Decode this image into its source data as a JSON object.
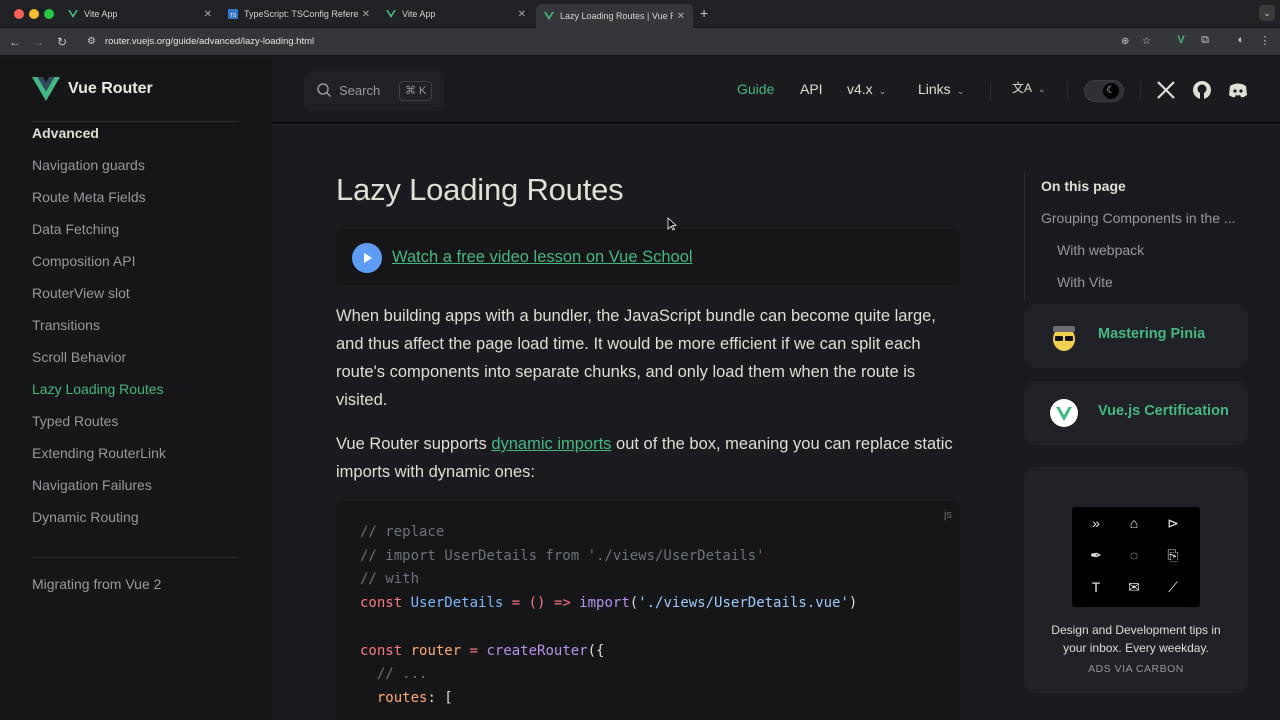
{
  "browser": {
    "tabs": [
      {
        "title": "Vite App",
        "favicon": "vue-icon"
      },
      {
        "title": "TypeScript: TSConfig Referen",
        "favicon": "typescript-icon"
      },
      {
        "title": "Vite App",
        "favicon": "vue-icon"
      },
      {
        "title": "Lazy Loading Routes | Vue Ro",
        "favicon": "vue-icon",
        "active": true
      }
    ],
    "new_tab": "+",
    "tab_menu": "⌄",
    "url": "router.vuejs.org/guide/advanced/lazy-loading.html"
  },
  "site": {
    "brand": "Vue Router",
    "search": {
      "label": "Search",
      "shortcut": "⌘ K"
    },
    "nav": [
      {
        "label": "Guide",
        "active": true
      },
      {
        "label": "API"
      },
      {
        "label": "v4.x",
        "dropdown": true
      },
      {
        "label": "Links",
        "dropdown": true
      }
    ],
    "lang_icon": "文A"
  },
  "sidebar": {
    "section": "Advanced",
    "items": [
      "Navigation guards",
      "Route Meta Fields",
      "Data Fetching",
      "Composition API",
      "RouterView slot",
      "Transitions",
      "Scroll Behavior",
      "Lazy Loading Routes",
      "Typed Routes",
      "Extending RouterLink",
      "Navigation Failures",
      "Dynamic Routing"
    ],
    "active_item": "Lazy Loading Routes",
    "footer_item": "Migrating from Vue 2"
  },
  "article": {
    "title": "Lazy Loading Routes",
    "video_link": "Watch a free video lesson on Vue School",
    "p1": "When building apps with a bundler, the JavaScript bundle can become quite large, and thus affect the page load time. It would be more efficient if we can split each route's components into separate chunks, and only load them when the route is visited.",
    "p2_before": "Vue Router supports ",
    "p2_link": "dynamic imports",
    "p2_after": " out of the box, meaning you can replace static imports with dynamic ones:",
    "code_lang": "js",
    "code": {
      "l1": "// replace",
      "l2": "// import UserDetails from './views/UserDetails'",
      "l3": "// with",
      "l4_kw": "const",
      "l4_id": " UserDetails",
      "l4_op": " = () => ",
      "l4_fn": "import",
      "l4_str": "'./views/UserDetails.vue'",
      "l6_kw": "const",
      "l6_var": " router",
      "l6_op": " = ",
      "l6_fn": "createRouter",
      "l6_tail": "({",
      "l7": "  // ...",
      "l8_key": "  routes",
      "l8_tail": ": ["
    }
  },
  "aside": {
    "title": "On this page",
    "items": [
      "Grouping Components in the ...",
      "With webpack",
      "With Vite"
    ],
    "sponsors": [
      "Mastering Pinia",
      "Vue.js Certification"
    ],
    "ad_text": "Design and Development tips in your inbox. Every weekday.",
    "ad_via": "ADS VIA CARBON",
    "ad_icons": [
      "»",
      "⌂",
      "⊳",
      "✒",
      "◌",
      "⎘",
      "T",
      "✉",
      "⟋"
    ]
  },
  "colors": {
    "accent": "#42b883",
    "background": "#1b1b1f",
    "sidebar": "#161618"
  }
}
